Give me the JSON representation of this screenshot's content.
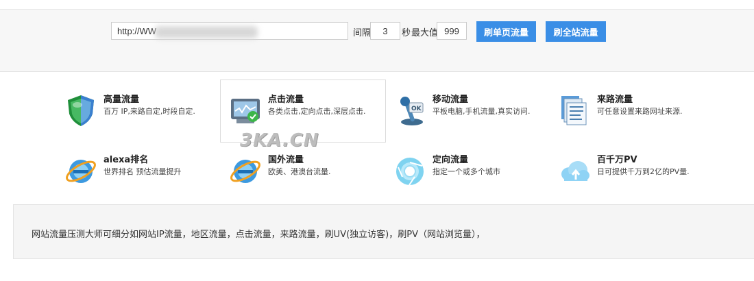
{
  "toolbar": {
    "url_value": "http://WW",
    "interval_label": "间隔",
    "interval_value": "3",
    "seconds_label": "秒",
    "max_label": "最大值",
    "max_value": "999",
    "single_page_button": "刷单页流量",
    "whole_site_button": "刷全站流量"
  },
  "features": [
    {
      "title": "高量流量",
      "desc": "百万 IP,来路自定,时段自定.",
      "icon": "shield-icon"
    },
    {
      "title": "点击流量",
      "desc": "各类点击,定向点击,深层点击.",
      "icon": "monitor-check-icon"
    },
    {
      "title": "移动流量",
      "desc": "平板电脑,手机流量,真实访问.",
      "icon": "joystick-icon"
    },
    {
      "title": "来路流量",
      "desc": "可任意设置来路网址来源.",
      "icon": "documents-icon"
    },
    {
      "title": "alexa排名",
      "desc": "世界排名 预估流量提升",
      "icon": "ie-globe-icon"
    },
    {
      "title": "国外流量",
      "desc": "欧美、港澳台流量.",
      "icon": "ie-globe-icon"
    },
    {
      "title": "定向流量",
      "desc": "指定一个或多个城市",
      "icon": "chrome-icon"
    },
    {
      "title": "百千万PV",
      "desc": "日可提供千万到2亿的PV量.",
      "icon": "cloud-upload-icon"
    }
  ],
  "watermark": "3KA.CN",
  "info_text": "网站流量压测大师可细分如网站IP流量，地区流量，点击流量，来路流量，刷UV(独立访客)，刷PV（网站浏览量），",
  "colors": {
    "button": "#3a8ee6",
    "toolbar_bg": "#f7f7f7",
    "info_bg": "#f5f5f5"
  }
}
